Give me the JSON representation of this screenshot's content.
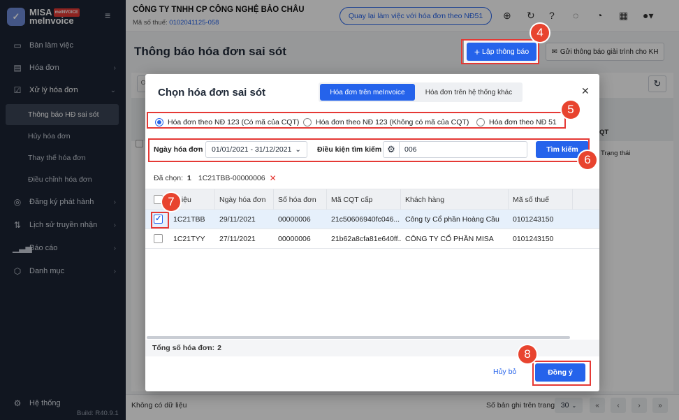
{
  "sidebar": {
    "brand": "MISA",
    "brand_badge": "meINVOICE",
    "product": "meInvoice",
    "items": [
      {
        "label": "Bàn làm việc",
        "icon": "monitor-icon"
      },
      {
        "label": "Hóa đơn",
        "icon": "document-icon"
      },
      {
        "label": "Xử lý hóa đơn",
        "icon": "document-check-icon"
      },
      {
        "label": "Đăng ký phát hành",
        "icon": "seal-icon"
      },
      {
        "label": "Lịch sử truyền nhận",
        "icon": "transfer-icon"
      },
      {
        "label": "Báo cáo",
        "icon": "bar-chart-icon"
      },
      {
        "label": "Danh mục",
        "icon": "box-icon"
      }
    ],
    "subitems": [
      "Thông báo HĐ sai sót",
      "Hủy hóa đơn",
      "Thay thế hóa đơn",
      "Điều chỉnh hóa đơn"
    ],
    "settings": "Hệ thống",
    "build": "Build: R40.9.1"
  },
  "topbar": {
    "company": "CÔNG TY TNHH CP CÔNG NGHỆ BẢO CHÂU",
    "tax_label": "Mã số thuế:",
    "tax_code": "0102041125-058",
    "back_button": "Quay lại làm việc với hóa đơn theo NĐ51"
  },
  "page": {
    "title": "Thông báo hóa đơn sai sót",
    "create_button": "Lập thông báo",
    "explain_button": "Gửi thông báo giải trình cho KH",
    "bg_col_header": "QT",
    "bg_col_status": "Trạng thái"
  },
  "dialog": {
    "title": "Chọn hóa đơn sai sót",
    "tabs": [
      "Hóa đơn trên meInvoice",
      "Hóa đơn trên hệ thống khác"
    ],
    "radios": [
      {
        "label": "Hóa đơn theo NĐ 123 (Có mã của CQT)",
        "checked": true
      },
      {
        "label": "Hóa đơn theo NĐ 123 (Không có mã của CQT)",
        "checked": false
      },
      {
        "label": "Hóa đơn theo NĐ 51",
        "checked": false
      }
    ],
    "date_label": "Ngày hóa đơn",
    "date_value": "01/01/2021 - 31/12/2021",
    "cond_label": "Điều kiện tìm kiếm",
    "cond_value": "006",
    "search_button": "Tìm kiếm",
    "selected_label": "Đã chọn:",
    "selected_count": "1",
    "selected_item": "1C21TBB-00000006",
    "columns": [
      "hiệu",
      "Ngày hóa đơn",
      "Số hóa đơn",
      "Mã CQT cấp",
      "Khách hàng",
      "Mã số thuế"
    ],
    "rows": [
      {
        "checked": true,
        "symbol": "1C21TBB",
        "date": "29/11/2021",
        "number": "00000006",
        "cqt": "21c50606940fc046...",
        "customer": "Công ty Cổ phần Hoàng Cầu",
        "tax": "0101243150"
      },
      {
        "checked": false,
        "symbol": "1C21TYY",
        "date": "27/11/2021",
        "number": "00000006",
        "cqt": "21b62a8cfa81e640ff...",
        "customer": "CÔNG TY CỔ PHẦN MISA",
        "tax": "0101243150"
      }
    ],
    "total_label": "Tổng số hóa đơn:",
    "total_value": "2",
    "cancel_button": "Hủy bỏ",
    "ok_button": "Đồng ý"
  },
  "footer": {
    "no_data": "Không có dữ liệu",
    "rows_label": "Số bản ghi trên trang",
    "rows_value": "30"
  },
  "steps": [
    "4",
    "5",
    "6",
    "7",
    "8"
  ],
  "colors": {
    "accent": "#2563eb",
    "sidebar": "#1c2434",
    "highlight": "#e53935"
  }
}
